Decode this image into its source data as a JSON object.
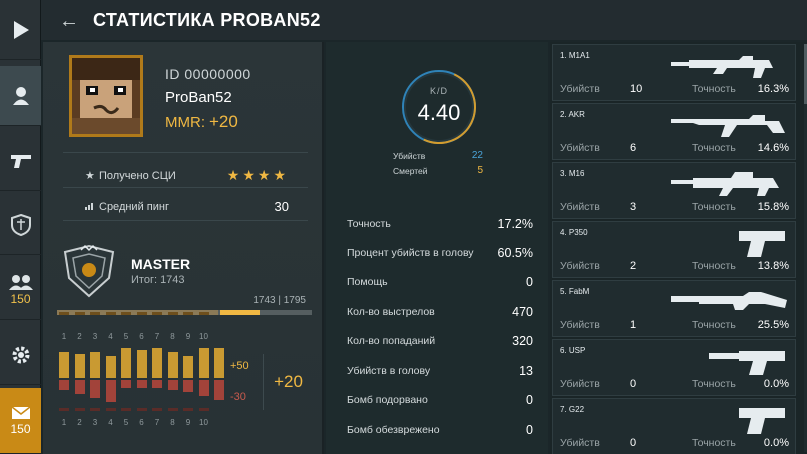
{
  "header": {
    "title": "СТАТИСТИКА PROBAN52"
  },
  "rail": {
    "items": [
      {
        "icon": "play-icon"
      },
      {
        "icon": "profile-icon"
      },
      {
        "icon": "pistol-icon"
      },
      {
        "icon": "clan-shield-icon"
      },
      {
        "icon": "friends-icon",
        "count": "150"
      },
      {
        "icon": "gear-icon"
      },
      {
        "icon": "mail-icon",
        "count": "150"
      }
    ]
  },
  "profile": {
    "id": "ID 00000000",
    "name": "ProBan52",
    "mmr_label": "MMR:",
    "mmr_value": "+20"
  },
  "stats": {
    "received_label": "Получено СЦИ",
    "stars": "★★★★",
    "ping_label": "Средний пинг",
    "ping_value": "30"
  },
  "rank": {
    "name": "MASTER",
    "total": "Итог: 1743",
    "progress_text": "1743 | 1795",
    "progress_fraction": 0.97
  },
  "history": {
    "labels": [
      "1",
      "2",
      "3",
      "4",
      "5",
      "6",
      "7",
      "8",
      "9",
      "10"
    ],
    "positive": [
      26,
      24,
      26,
      22,
      30,
      28,
      30,
      26,
      22,
      30
    ],
    "negative": [
      10,
      14,
      18,
      22,
      8,
      8,
      8,
      10,
      12,
      16
    ],
    "pos_delta": "+50",
    "neg_delta": "-30",
    "total_delta": "+20"
  },
  "kd": {
    "label": "K/D",
    "value": "4.40",
    "kills_label": "Убийств",
    "kills_value": "22",
    "deaths_label": "Смертей",
    "deaths_value": "5"
  },
  "main_stats": [
    {
      "label": "Точность",
      "value": "17.2%"
    },
    {
      "label": "Процент убийств в голову",
      "value": "60.5%"
    },
    {
      "label": "Помощь",
      "value": "0"
    },
    {
      "label": "Кол-во выстрелов",
      "value": "470"
    },
    {
      "label": "Кол-во попаданий",
      "value": "320"
    },
    {
      "label": "Убийств в голову",
      "value": "13"
    },
    {
      "label": "Бомб подорвано",
      "value": "0"
    },
    {
      "label": "Бомб обезврежено",
      "value": "0"
    }
  ],
  "weapons": [
    {
      "name": "1. M1A1",
      "kills": "10",
      "accuracy": "16.3%",
      "kind": "rifle"
    },
    {
      "name": "2. AKR",
      "kills": "6",
      "accuracy": "14.6%",
      "kind": "ak"
    },
    {
      "name": "3. M16",
      "kills": "3",
      "accuracy": "15.8%",
      "kind": "m16"
    },
    {
      "name": "4. P350",
      "kills": "2",
      "accuracy": "13.8%",
      "kind": "pistol"
    },
    {
      "name": "5. FabM",
      "kills": "1",
      "accuracy": "25.5%",
      "kind": "shotgun"
    },
    {
      "name": "6. USP",
      "kills": "0",
      "accuracy": "0.0%",
      "kind": "silenced-pistol"
    },
    {
      "name": "7. G22",
      "kills": "0",
      "accuracy": "0.0%",
      "kind": "pistol"
    }
  ],
  "weapon_labels": {
    "kills": "Убийств",
    "accuracy": "Точность"
  },
  "colors": {
    "accent": "#f0b843",
    "negative": "#c85a4e",
    "ring_blue": "#2f83b8"
  }
}
